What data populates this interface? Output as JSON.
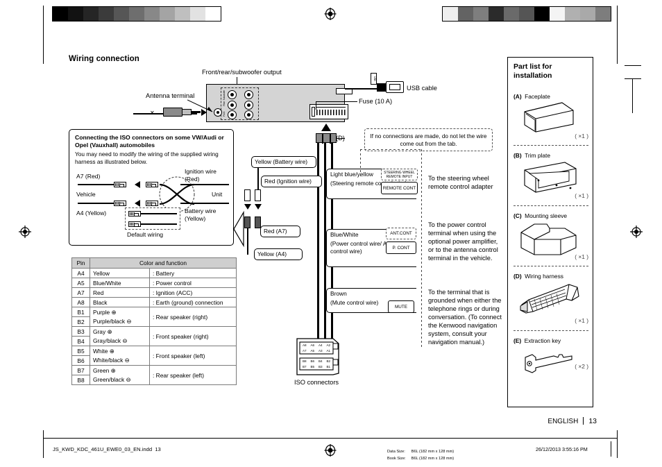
{
  "document": {
    "section_title": "Wiring connection",
    "language_footer": "ENGLISH",
    "page_number": "13",
    "file_name": "JS_KWD_KDC_461U_EWE0_03_EN.indd",
    "file_page": "13",
    "data_size_label": "Data Size:",
    "data_size_value": "B6L (182 mm x 128 mm)",
    "book_size_label": "Book Size:",
    "book_size_value": "B6L (182 mm x 128 mm)",
    "timestamp": "26/12/2013   3:55:16 PM"
  },
  "diagram": {
    "labels": {
      "front_rear_sub": "Front/rear/subwoofer output",
      "antenna_terminal": "Antenna terminal",
      "usb_cable": "USB cable",
      "fuse": "Fuse (10 A)",
      "harness_ref": "(D)",
      "iso_connectors": "ISO connectors",
      "usb_logo": "USB"
    },
    "rca_labels": [
      "Subwoofer",
      "Rear",
      "Front"
    ],
    "notice_box": "If no connections are made, do not let the wire come out from the tab.",
    "iso_note": {
      "title": "Connecting the ISO connectors on some VW/Audi or Opel (Vauxhall) automobiles",
      "body": "You may need to modify the wiring of the supplied wiring harness as illustrated below.",
      "left_top": "A7 (Red)",
      "left_mid": "Vehicle",
      "left_bottom": "A4 (Yellow)",
      "right_top": "Ignition wire (Red)",
      "right_mid": "Unit",
      "right_bottom": "Battery wire (Yellow)",
      "default_wiring": "Default wiring"
    },
    "harness_wires": {
      "battery": "Yellow (Battery wire)",
      "ignition": "Red (Ignition wire)",
      "red_a7": "Red (A7)",
      "yellow_a4": "Yellow (A4)"
    },
    "connections": [
      {
        "wire": "Light blue/yellow",
        "wire_sub": "(Steering remote control wire)",
        "tag_dashed": "STEERING WHEEL REMOTE INPUT",
        "tag_solid": "REMOTE CONT",
        "destination": "To the steering wheel remote control adapter"
      },
      {
        "wire": "Blue/White",
        "wire_sub": "(Power control wire/ Antenna control wire)",
        "tag_dashed": "ANT.CONT",
        "tag_solid": "P. CONT",
        "destination": "To the power control terminal when using the optional power amplifier, or to the antenna control terminal in the vehicle."
      },
      {
        "wire": "Brown",
        "wire_sub": "(Mute control wire)",
        "tag_dashed": "",
        "tag_solid": "MUTE",
        "destination": "To the terminal that is grounded when either the telephone rings or during conversation. (To connect the Kenwood navigation system, consult your navigation manual.)"
      }
    ],
    "iso_pins": {
      "a_row_top": [
        "A8",
        "A6",
        "A4",
        "A2"
      ],
      "a_row_bottom": [
        "A7",
        "A5",
        "A3",
        "A1"
      ],
      "b_row_top": [
        "B8",
        "B6",
        "B4",
        "B2"
      ],
      "b_row_bottom": [
        "B7",
        "B5",
        "B3",
        "B1"
      ]
    }
  },
  "pin_table": {
    "headers": [
      "Pin",
      "Color and function"
    ],
    "rows": [
      {
        "pin": "A4",
        "color": "Yellow",
        "function": ": Battery",
        "span": 1
      },
      {
        "pin": "A5",
        "color": "Blue/White",
        "function": ": Power control",
        "span": 1
      },
      {
        "pin": "A7",
        "color": "Red",
        "function": ": Ignition (ACC)",
        "span": 1
      },
      {
        "pin": "A8",
        "color": "Black",
        "function": ": Earth (ground) connection",
        "span": 1
      },
      {
        "pin": "B1",
        "color": "Purple ⊕",
        "function": ": Rear speaker (right)",
        "span": 2
      },
      {
        "pin": "B2",
        "color": "Purple/black ⊖",
        "function": "",
        "span": 0
      },
      {
        "pin": "B3",
        "color": "Gray ⊕",
        "function": ": Front speaker (right)",
        "span": 2
      },
      {
        "pin": "B4",
        "color": "Gray/black ⊖",
        "function": "",
        "span": 0
      },
      {
        "pin": "B5",
        "color": "White ⊕",
        "function": ": Front speaker (left)",
        "span": 2
      },
      {
        "pin": "B6",
        "color": "White/black ⊖",
        "function": "",
        "span": 0
      },
      {
        "pin": "B7",
        "color": "Green ⊕",
        "function": ": Rear speaker (left)",
        "span": 2
      },
      {
        "pin": "B8",
        "color": "Green/black ⊖",
        "function": "",
        "span": 0
      }
    ]
  },
  "part_list": {
    "title": "Part list for installation",
    "items": [
      {
        "ref": "(A)",
        "name": "Faceplate",
        "qty": "( ×1 )"
      },
      {
        "ref": "(B)",
        "name": "Trim plate",
        "qty": "( ×1 )"
      },
      {
        "ref": "(C)",
        "name": "Mounting sleeve",
        "qty": "( ×1 )"
      },
      {
        "ref": "(D)",
        "name": "Wiring harness",
        "qty": "( ×1 )"
      },
      {
        "ref": "(E)",
        "name": "Extraction key",
        "qty": "( ×2 )"
      }
    ]
  },
  "colors": {
    "page_background": "#ffffff",
    "unit_body": "#d4d4d4",
    "table_header": "#cfcfcf",
    "ink": "#000000"
  },
  "calibration": {
    "left_bar_steps": [
      "#000000",
      "#121212",
      "#252525",
      "#3b3b3b",
      "#565656",
      "#6e6e6e",
      "#888888",
      "#a4a4a4",
      "#bfbfbf",
      "#e2e2e2",
      "#ffffff"
    ],
    "right_bar_steps": [
      "#efefef",
      "#636363",
      "#7e7e7e",
      "#2b2b2b",
      "#6a6a6a",
      "#555555",
      "#000000",
      "#f4f4f4",
      "#b0b0b0",
      "#a9a9a9",
      "#7d7d7d"
    ]
  }
}
